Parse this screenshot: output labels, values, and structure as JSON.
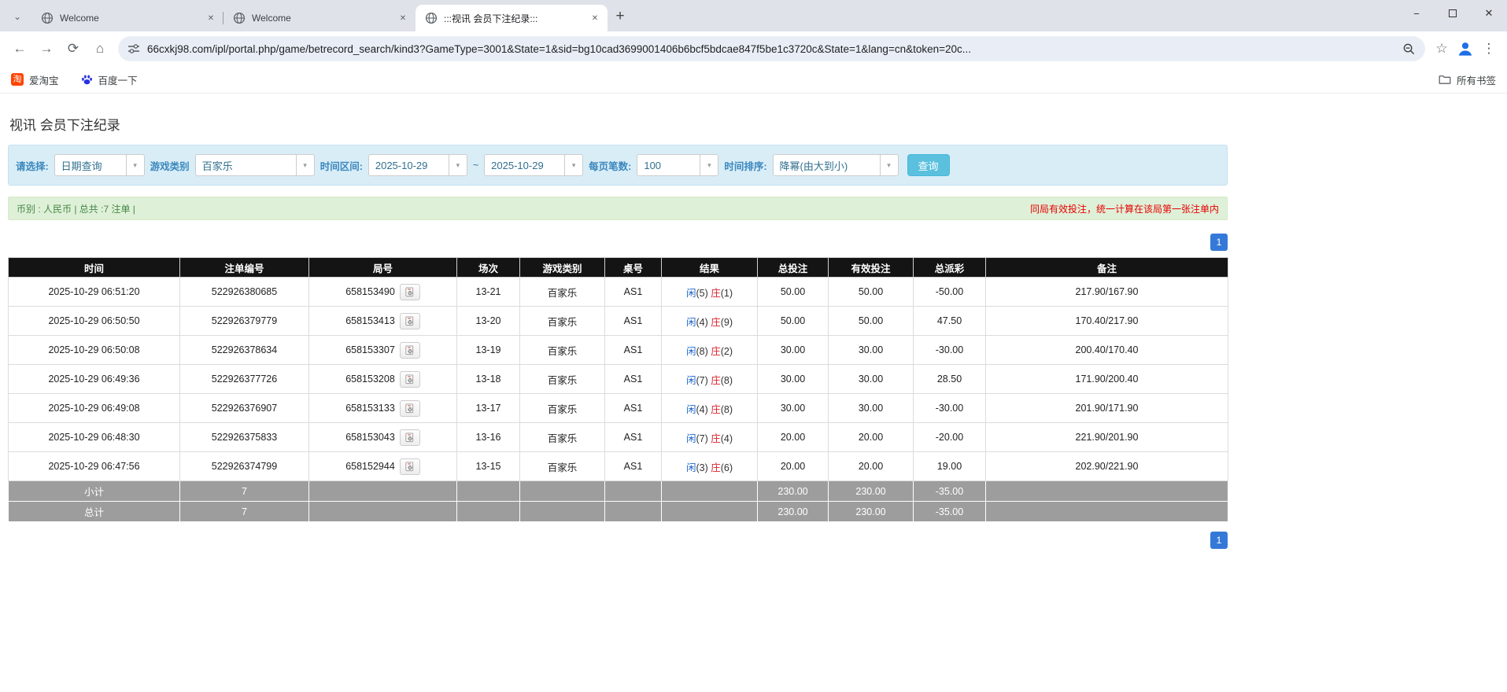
{
  "browser": {
    "tabs": [
      {
        "title": "Welcome"
      },
      {
        "title": "Welcome"
      },
      {
        "title": ":::视讯 会员下注纪录:::"
      }
    ],
    "url": "66cxkj98.com/ipl/portal.php/game/betrecord_search/kind3?GameType=3001&State=1&sid=bg10cad3699001406b6bcf5bdcae847f5be1c3720c&State=1&lang=cn&token=20c...",
    "bookmarks": [
      {
        "label": "爱淘宝",
        "icon_text": "淘"
      },
      {
        "label": "百度一下"
      }
    ],
    "all_bookmarks_label": "所有书签"
  },
  "page": {
    "title": "视讯 会员下注纪录",
    "filters": {
      "select_label": "请选择:",
      "select_value": "日期查询",
      "game_type_label": "游戏类别",
      "game_type_value": "百家乐",
      "time_range_label": "时间区间:",
      "date_from": "2025-10-29",
      "tilde": "~",
      "date_to": "2025-10-29",
      "page_size_label": "每页笔数:",
      "page_size_value": "100",
      "sort_label": "时间排序:",
      "sort_value": "降幂(由大到小)",
      "search_button": "查询"
    },
    "summary": {
      "left": "币别 : 人民币 | 总共 :7 注单 |",
      "right": "同局有效投注，统一计算在该局第一张注单内"
    },
    "pagination": "1",
    "colors": {
      "search_button": "#5bc0de",
      "pagination_blue": "#3579d8",
      "bet_link_blue": "#1a66cc",
      "loss_red": "#e60000",
      "player_blue": "#1a66cc",
      "banker_red": "#d9232e",
      "header_black": "#141414",
      "footer_gray": "#9d9d9d",
      "filter_bg": "#d9edf7",
      "summary_bg": "#dff0d8"
    },
    "table": {
      "headers": [
        "时间",
        "注单编号",
        "局号",
        "场次",
        "游戏类别",
        "桌号",
        "结果",
        "总投注",
        "有效投注",
        "总派彩",
        "备注"
      ],
      "rows": [
        {
          "time": "2025-10-29 06:51:20",
          "bet_id": "522926380685",
          "round_id": "658153490",
          "session": "13-21",
          "game": "百家乐",
          "table_no": "AS1",
          "result_player": "闲(5)",
          "result_banker": "庄(1)",
          "total_bet": "50.00",
          "valid_bet": "50.00",
          "payout": "-50.00",
          "remark": "217.90/167.90"
        },
        {
          "time": "2025-10-29 06:50:50",
          "bet_id": "522926379779",
          "round_id": "658153413",
          "session": "13-20",
          "game": "百家乐",
          "table_no": "AS1",
          "result_player": "闲(4)",
          "result_banker": "庄(9)",
          "total_bet": "50.00",
          "valid_bet": "50.00",
          "payout": "47.50",
          "remark": "170.40/217.90"
        },
        {
          "time": "2025-10-29 06:50:08",
          "bet_id": "522926378634",
          "round_id": "658153307",
          "session": "13-19",
          "game": "百家乐",
          "table_no": "AS1",
          "result_player": "闲(8)",
          "result_banker": "庄(2)",
          "total_bet": "30.00",
          "valid_bet": "30.00",
          "payout": "-30.00",
          "remark": "200.40/170.40"
        },
        {
          "time": "2025-10-29 06:49:36",
          "bet_id": "522926377726",
          "round_id": "658153208",
          "session": "13-18",
          "game": "百家乐",
          "table_no": "AS1",
          "result_player": "闲(7)",
          "result_banker": "庄(8)",
          "total_bet": "30.00",
          "valid_bet": "30.00",
          "payout": "28.50",
          "remark": "171.90/200.40"
        },
        {
          "time": "2025-10-29 06:49:08",
          "bet_id": "522926376907",
          "round_id": "658153133",
          "session": "13-17",
          "game": "百家乐",
          "table_no": "AS1",
          "result_player": "闲(4)",
          "result_banker": "庄(8)",
          "total_bet": "30.00",
          "valid_bet": "30.00",
          "payout": "-30.00",
          "remark": "201.90/171.90"
        },
        {
          "time": "2025-10-29 06:48:30",
          "bet_id": "522926375833",
          "round_id": "658153043",
          "session": "13-16",
          "game": "百家乐",
          "table_no": "AS1",
          "result_player": "闲(7)",
          "result_banker": "庄(4)",
          "total_bet": "20.00",
          "valid_bet": "20.00",
          "payout": "-20.00",
          "remark": "221.90/201.90"
        },
        {
          "time": "2025-10-29 06:47:56",
          "bet_id": "522926374799",
          "round_id": "658152944",
          "session": "13-15",
          "game": "百家乐",
          "table_no": "AS1",
          "result_player": "闲(3)",
          "result_banker": "庄(6)",
          "total_bet": "20.00",
          "valid_bet": "20.00",
          "payout": "19.00",
          "remark": "202.90/221.90"
        }
      ],
      "footers": [
        {
          "label": "小计",
          "count": "7",
          "total_bet": "230.00",
          "valid_bet": "230.00",
          "payout": "-35.00"
        },
        {
          "label": "总计",
          "count": "7",
          "total_bet": "230.00",
          "valid_bet": "230.00",
          "payout": "-35.00"
        }
      ]
    }
  }
}
